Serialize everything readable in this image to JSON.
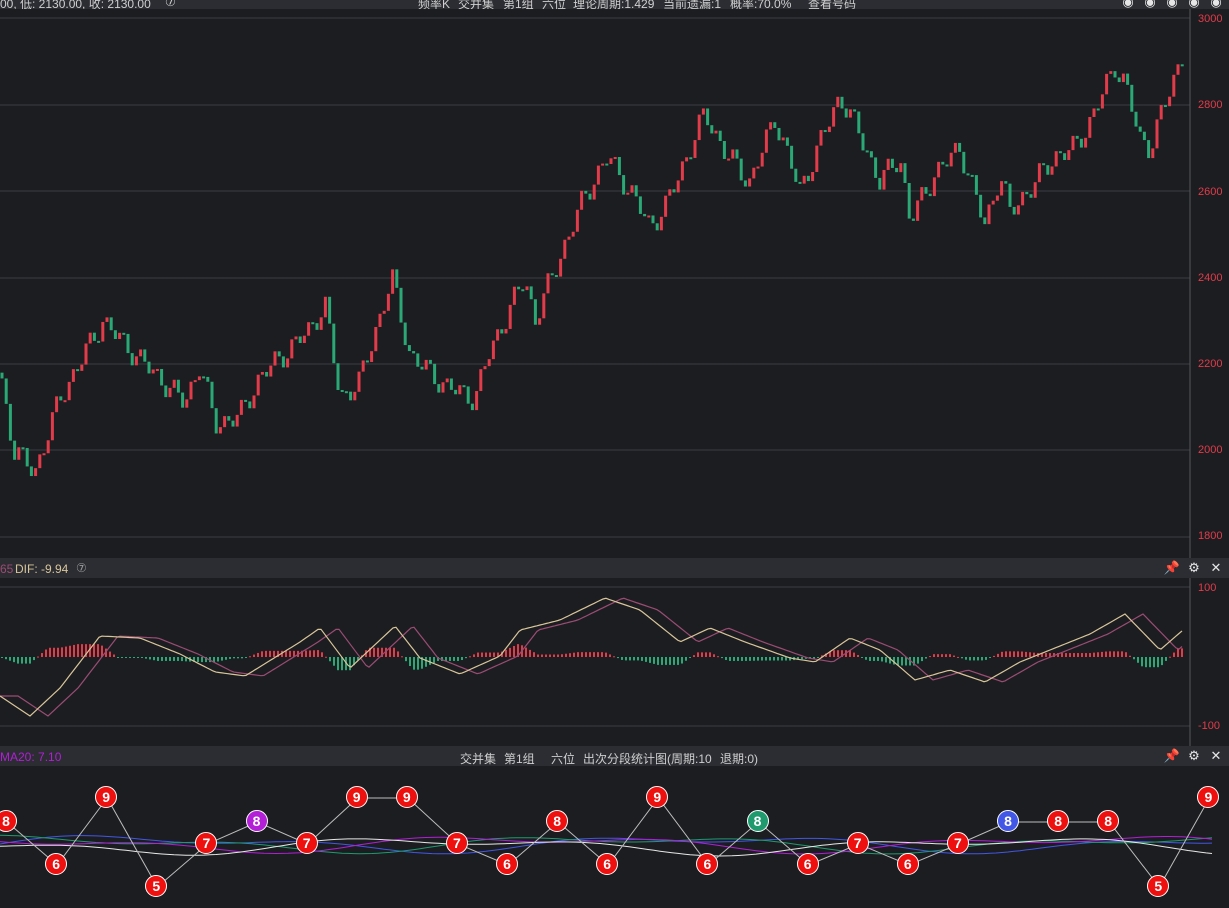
{
  "top_bar": {
    "left_text": "00, 低: 2130.00, 收: 2130.00",
    "center_items": [
      "频率K",
      "交并集",
      "第1组",
      "六位",
      "理论周期:1.429",
      "当前遗漏:1",
      "概率:70.0%",
      "查看号码"
    ]
  },
  "price_axis": {
    "labels": [
      "3000",
      "2800",
      "2600",
      "2400",
      "2200",
      "2000",
      "1800"
    ]
  },
  "macd_bar": {
    "prefix": "65",
    "dif_label": "DIF: -9.94"
  },
  "macd_axis": {
    "labels": [
      "100",
      "-100"
    ]
  },
  "seq_bar": {
    "ma_label": "MA20: 7.10",
    "title_items": [
      "交并集",
      "第1组",
      "六位",
      "出次分段统计图(周期:10",
      "退期:0)"
    ]
  },
  "sequence": [
    {
      "v": "8",
      "c": "red"
    },
    {
      "v": "6",
      "c": "red"
    },
    {
      "v": "9",
      "c": "red"
    },
    {
      "v": "5",
      "c": "red"
    },
    {
      "v": "7",
      "c": "red"
    },
    {
      "v": "8",
      "c": "purple"
    },
    {
      "v": "7",
      "c": "red"
    },
    {
      "v": "9",
      "c": "red"
    },
    {
      "v": "9",
      "c": "red"
    },
    {
      "v": "7",
      "c": "red"
    },
    {
      "v": "6",
      "c": "red"
    },
    {
      "v": "8",
      "c": "red"
    },
    {
      "v": "6",
      "c": "red"
    },
    {
      "v": "9",
      "c": "red"
    },
    {
      "v": "6",
      "c": "red"
    },
    {
      "v": "8",
      "c": "green"
    },
    {
      "v": "6",
      "c": "red"
    },
    {
      "v": "7",
      "c": "red"
    },
    {
      "v": "6",
      "c": "red"
    },
    {
      "v": "7",
      "c": "red"
    },
    {
      "v": "8",
      "c": "blue"
    },
    {
      "v": "8",
      "c": "red"
    },
    {
      "v": "8",
      "c": "red"
    },
    {
      "v": "5",
      "c": "red"
    },
    {
      "v": "9",
      "c": "red"
    }
  ],
  "node_colors": {
    "red": "#ee0f0f",
    "purple": "#b21fd6",
    "green": "#1f9a6e",
    "blue": "#4257e6"
  },
  "colors": {
    "up": "#e23c4a",
    "down": "#2aa876",
    "grid": "#3b3d42",
    "dif": "#d9c59a",
    "dea": "#9b4c74"
  }
}
